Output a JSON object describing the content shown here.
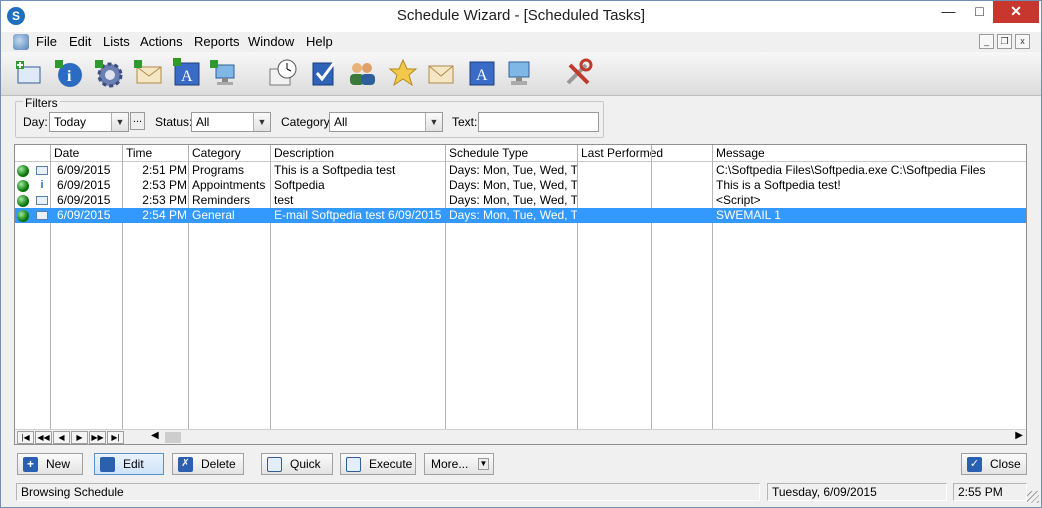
{
  "window": {
    "title": "Schedule Wizard - [Scheduled Tasks]",
    "app_icon_letter": "S"
  },
  "menu": [
    "File",
    "Edit",
    "Lists",
    "Actions",
    "Reports",
    "Window",
    "Help"
  ],
  "toolbar_icons": [
    "new-task-icon",
    "info-icon",
    "settings-gear-icon",
    "email-icon",
    "text-a-icon",
    "network-computer-icon",
    "clock-schedule-icon",
    "checklist-icon",
    "users-icon",
    "star-icon",
    "email-message-icon",
    "text-a-icon",
    "computer-icon",
    "tools-icon"
  ],
  "filters": {
    "legend": "Filters",
    "day_label": "Day:",
    "day_value": "Today",
    "day_more": "...",
    "status_label": "Status:",
    "status_value": "All",
    "category_label": "Category:",
    "category_value": "All",
    "text_label": "Text:",
    "text_value": ""
  },
  "grid": {
    "columns": [
      "Date",
      "Time",
      "Category",
      "Description",
      "Schedule Type",
      "Last Performed",
      "",
      "Message"
    ],
    "rows": [
      {
        "date": "6/09/2015",
        "time": "2:51 PM",
        "category": "Programs",
        "description": "This is a Softpedia test",
        "schedule": "Days: Mon, Tue, Wed, Thu",
        "last": "",
        "message": "C:\\Softpedia Files\\Softpedia.exe C:\\Softpedia Files",
        "selected": false
      },
      {
        "date": "6/09/2015",
        "time": "2:53 PM",
        "category": "Appointments",
        "description": "Softpedia",
        "schedule": "Days: Mon, Tue, Wed, Thu",
        "last": "",
        "message": "This is a Softpedia test!",
        "selected": false
      },
      {
        "date": "6/09/2015",
        "time": "2:53 PM",
        "category": "Reminders",
        "description": "test",
        "schedule": "Days: Mon, Tue, Wed, Thu",
        "last": "",
        "message": "<Script>",
        "selected": false
      },
      {
        "date": "6/09/2015",
        "time": "2:54 PM",
        "category": "General",
        "description": "E-mail Softpedia test  6/09/2015",
        "schedule": "Days: Mon, Tue, Wed, Thu",
        "last": "",
        "message": "SWEMAIL 1",
        "selected": true
      }
    ],
    "nav": [
      "|◀",
      "◀◀",
      "◀",
      "▶",
      "▶▶",
      "▶|"
    ]
  },
  "buttons": {
    "new": "New",
    "edit": "Edit",
    "delete": "Delete",
    "quick": "Quick",
    "execute": "Execute",
    "more": "More...",
    "close": "Close"
  },
  "statusbar": {
    "message": "Browsing Schedule",
    "date": "Tuesday,  6/09/2015",
    "time": "2:55 PM"
  },
  "colors": {
    "selection": "#3399ff",
    "close_button": "#c7372e"
  }
}
